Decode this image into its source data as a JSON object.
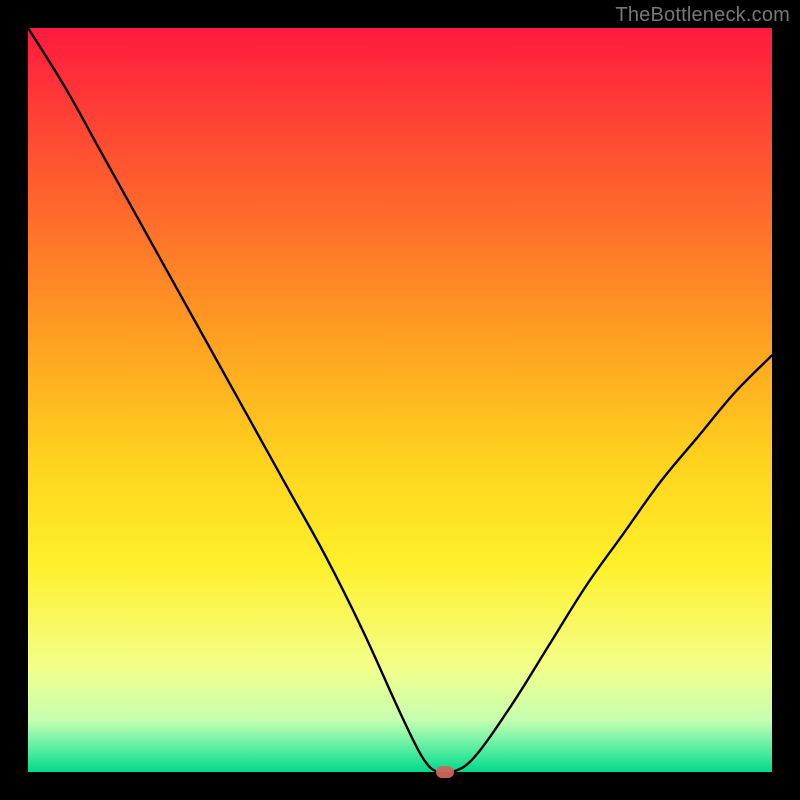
{
  "watermark": "TheBottleneck.com",
  "chart_data": {
    "type": "line",
    "title": "",
    "xlabel": "",
    "ylabel": "",
    "xlim": [
      0,
      100
    ],
    "ylim": [
      0,
      100
    ],
    "grid": false,
    "legend": false,
    "series": [
      {
        "name": "bottleneck-curve",
        "x": [
          0,
          5,
          10,
          15,
          20,
          25,
          30,
          35,
          40,
          45,
          50,
          53,
          55,
          57,
          60,
          65,
          70,
          75,
          80,
          85,
          90,
          95,
          100
        ],
        "y": [
          100,
          92,
          83,
          74,
          65,
          56,
          47,
          38,
          29,
          19,
          8,
          2,
          0,
          0,
          2,
          9,
          17,
          25,
          32,
          39,
          45,
          51,
          56
        ]
      }
    ],
    "marker": {
      "x": 56,
      "y": 0,
      "color": "#cf645b"
    },
    "gradient_stops": [
      {
        "offset": 0.0,
        "color": "#ff1a3f"
      },
      {
        "offset": 0.2,
        "color": "#ff5a2e"
      },
      {
        "offset": 0.4,
        "color": "#ff9a22"
      },
      {
        "offset": 0.58,
        "color": "#ffd21e"
      },
      {
        "offset": 0.72,
        "color": "#fff029"
      },
      {
        "offset": 0.86,
        "color": "#f3ff8a"
      },
      {
        "offset": 0.93,
        "color": "#c6ffb0"
      },
      {
        "offset": 0.965,
        "color": "#63f0a4"
      },
      {
        "offset": 1.0,
        "color": "#00d98c"
      }
    ]
  }
}
